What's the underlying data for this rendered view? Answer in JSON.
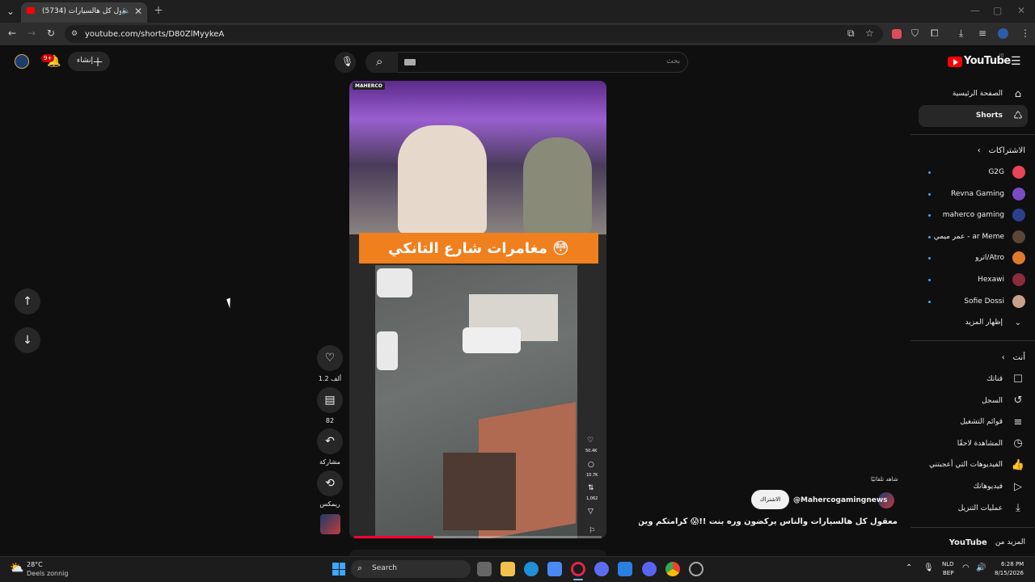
{
  "browser": {
    "tab_title": "(5734) معقول كل هالسيارات",
    "url": "youtube.com/shorts/D80ZlMyykeA"
  },
  "header": {
    "logo_text": "YouTube",
    "logo_region": "IQ",
    "search_placeholder": "بحث",
    "create_label": "إنشاء",
    "notification_count": "9+"
  },
  "sidebar": {
    "home": "الصفحة الرئيسية",
    "shorts": "Shorts",
    "subscriptions_heading": "الاشتراكات",
    "subscriptions": [
      {
        "name": "G2G",
        "color": "#e8445a"
      },
      {
        "name": "Revna Gaming",
        "color": "#7b4bc4"
      },
      {
        "name": "maherco gaming",
        "color": "#2c3e8c"
      },
      {
        "name": "عمر ميمي - ar Meme",
        "color": "#5a4636"
      },
      {
        "name": "اترو/Atro",
        "color": "#e07a2a"
      },
      {
        "name": "Hexawi",
        "color": "#8a2c3c"
      },
      {
        "name": "Sofie Dossi",
        "color": "#c9a08a"
      }
    ],
    "show_more": "إظهار المزيد",
    "you_heading": "أنت",
    "you_items": [
      {
        "label": "قناتك",
        "icon": "channel-icon"
      },
      {
        "label": "السجل",
        "icon": "history-icon"
      },
      {
        "label": "قوائم التشغيل",
        "icon": "playlists-icon"
      },
      {
        "label": "المشاهدة لاحقًا",
        "icon": "watch-later-icon"
      },
      {
        "label": "الفيديوهات التي أعجبتني",
        "icon": "liked-icon"
      },
      {
        "label": "فيديوهاتك",
        "icon": "your-videos-icon"
      },
      {
        "label": "عمليات التنزيل",
        "icon": "downloads-icon"
      }
    ],
    "more_from": "المزيد من",
    "more_from_brand": "YouTube"
  },
  "video": {
    "overlay_title": "مغامرات شارع التانكي",
    "channel_watermark": "MAHERCO",
    "likes": "1.2 ألف",
    "comments": "82",
    "share": "مشاركة",
    "remix": "ريمكس",
    "inner_likes": "50.4K",
    "inner_comments": "10.7K",
    "inner_remix": "1,062"
  },
  "meta": {
    "channel": "@Mahercogamingnews",
    "subscribe": "الاشتراك",
    "subscribed_note": "شاهد تلقائيًا",
    "title": "معقول كل هالسيارات والناس يركضون وره بنت !!😱 كرامتكم وين 💔 ..."
  },
  "taskbar": {
    "temp": "28°C",
    "weather": "Deels zonnig",
    "search": "Search",
    "lang1": "NLD",
    "lang2": "BEP",
    "time": "6:28 PM",
    "date": "8/15/2026"
  }
}
